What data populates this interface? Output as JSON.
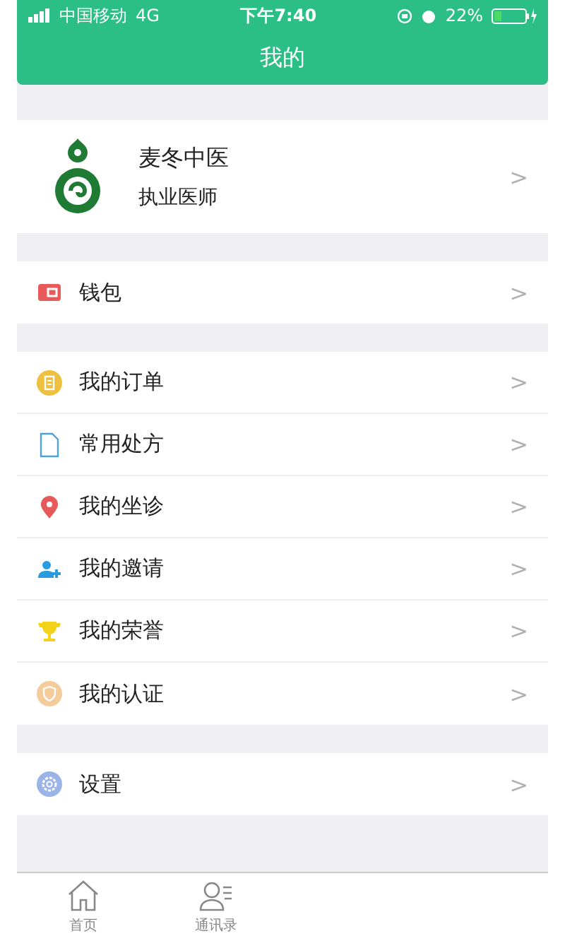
{
  "status_bar": {
    "carrier": "中国移动",
    "network": "4G",
    "time": "下午7:40",
    "battery": "22%"
  },
  "header": {
    "title": "我的"
  },
  "profile": {
    "name": "麦冬中医",
    "role": "执业医师",
    "chevron": ">"
  },
  "sections": [
    [
      {
        "label": "钱包",
        "kind": "wallet",
        "chevron": ">"
      }
    ],
    [
      {
        "label": "我的订单",
        "kind": "order",
        "chevron": ">"
      },
      {
        "label": "常用处方",
        "kind": "document",
        "chevron": ">"
      },
      {
        "label": "我的坐诊",
        "kind": "pin",
        "chevron": ">"
      },
      {
        "label": "我的邀请",
        "kind": "invite",
        "chevron": ">"
      },
      {
        "label": "我的荣誉",
        "kind": "trophy",
        "chevron": ">"
      },
      {
        "label": "我的认证",
        "kind": "shield",
        "chevron": ">"
      }
    ],
    [
      {
        "label": "设置",
        "kind": "gear",
        "chevron": ">"
      }
    ]
  ],
  "tab_bar": [
    {
      "label": "首页",
      "kind": "home",
      "selected": false
    },
    {
      "label": "通讯录",
      "kind": "contacts",
      "selected": false
    }
  ]
}
